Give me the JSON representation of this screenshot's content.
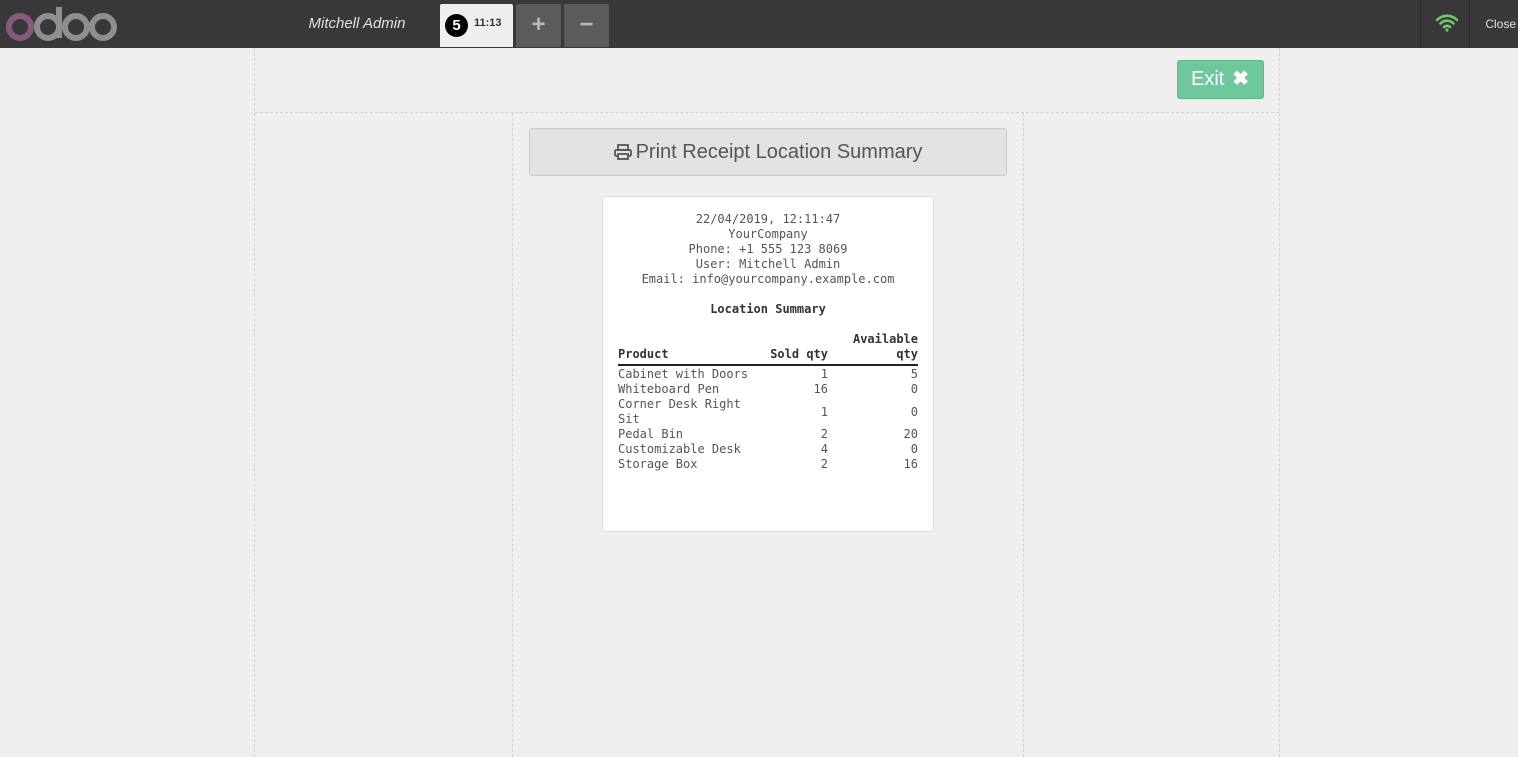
{
  "topbar": {
    "cashier": "Mitchell Admin",
    "order": {
      "number": "5",
      "time": "11:13"
    },
    "add_label": "+",
    "remove_label": "−",
    "close_label": "Close"
  },
  "screen": {
    "exit_label": "Exit",
    "print_label": "Print Receipt Location Summary"
  },
  "receipt": {
    "datetime": "22/04/2019, 12:11:47",
    "company": "YourCompany",
    "phone": "Phone: +1 555 123 8069",
    "user": "User: Mitchell Admin",
    "email": "Email: info@yourcompany.example.com",
    "title": "Location Summary",
    "columns": [
      "Product",
      "Sold qty",
      "Available qty"
    ],
    "rows": [
      {
        "product": "Cabinet with Doors",
        "sold": "1",
        "available": "5"
      },
      {
        "product": "Whiteboard Pen",
        "sold": "16",
        "available": "0"
      },
      {
        "product": "Corner Desk Right Sit",
        "sold": "1",
        "available": "0"
      },
      {
        "product": "Pedal Bin",
        "sold": "2",
        "available": "20"
      },
      {
        "product": "Customizable Desk",
        "sold": "4",
        "available": "0"
      },
      {
        "product": "Storage Box",
        "sold": "2",
        "available": "16"
      }
    ]
  },
  "colors": {
    "topbar": "#393939",
    "exit_button": "#6ec89b",
    "wifi": "#6ec86e",
    "logo_o": "#875a7b",
    "logo_rest": "#8f8f8f"
  },
  "icons": {
    "logo": "odoo-logo",
    "wifi": "wifi-icon",
    "exit": "close-x-icon",
    "print": "printer-icon"
  }
}
